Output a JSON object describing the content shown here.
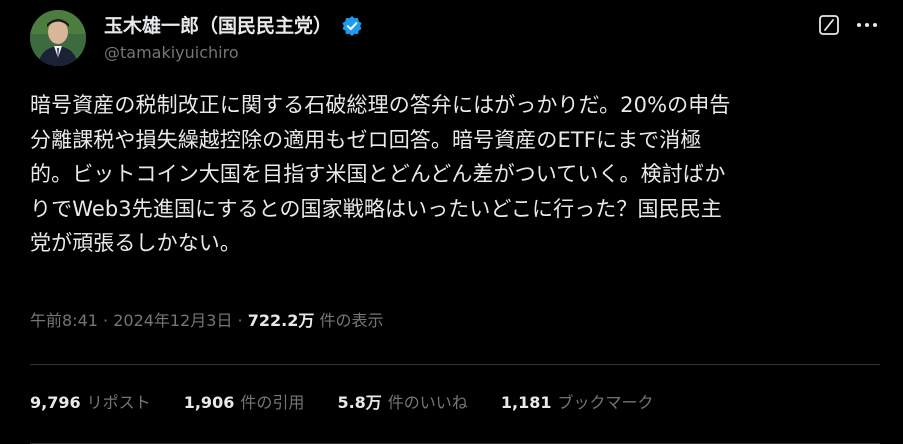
{
  "author": {
    "display_name": "玉木雄一郎（国民民主党）",
    "handle": "@tamakiyuichiro"
  },
  "tweet": {
    "text": "暗号資産の税制改正に関する石破総理の答弁にはがっかりだ。20%の申告\n分離課税や損失繰越控除の適用もゼロ回答。暗号資産のETFにまで消極\n的。ビットコイン大国を目指す米国とどんどん差がついていく。検討ばか\nりでWeb3先進国にするとの国家戦略はいったいどこに行った？国民民主\n党が頑張るしかない。"
  },
  "meta": {
    "time": "午前8:41",
    "separator1": " · ",
    "date": "2024年12月3日",
    "separator2": " · ",
    "views_count": "722.2万",
    "views_label": " 件の表示"
  },
  "stats": {
    "reposts": {
      "count": "9,796",
      "label": "リポスト"
    },
    "quotes": {
      "count": "1,906",
      "label": "件の引用"
    },
    "likes": {
      "count": "5.8万",
      "label": "件のいいね"
    },
    "bookmarks": {
      "count": "1,181",
      "label": "ブックマーク"
    }
  },
  "icons": {
    "verified": "verified-badge-icon",
    "grok": "grok-icon",
    "more": "more-options-icon"
  },
  "colors": {
    "background": "#000000",
    "text": "#e7e9ea",
    "secondary": "#71767b",
    "verified": "#1d9bf0",
    "divider": "#2f3336"
  }
}
